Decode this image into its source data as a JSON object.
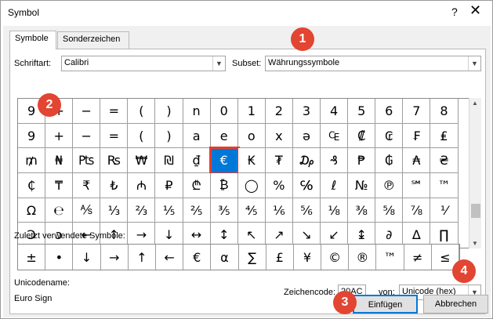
{
  "window": {
    "title": "Symbol",
    "help": "?",
    "close": "✕"
  },
  "tabs": [
    {
      "label": "Symbole"
    },
    {
      "label": "Sonderzeichen"
    }
  ],
  "font": {
    "label": "Schriftart:",
    "value": "Calibri"
  },
  "subset": {
    "label": "Subset:",
    "value": "Währungssymbole"
  },
  "symbol_grid": [
    [
      "9",
      "+",
      "−",
      "=",
      "(",
      ")",
      "n",
      "0",
      "1",
      "2",
      "3",
      "4",
      "5",
      "6",
      "7",
      "8"
    ],
    [
      "9",
      "+",
      "−",
      "=",
      "(",
      ")",
      "a",
      "e",
      "o",
      "x",
      "ə",
      "₠",
      "₡",
      "₢",
      "₣",
      "₤"
    ],
    [
      "₥",
      "₦",
      "₧",
      "₨",
      "₩",
      "₪",
      "₫",
      "€",
      "₭",
      "₮",
      "₯",
      "₰",
      "₱",
      "₲",
      "₳",
      "₴"
    ],
    [
      "₵",
      "₸",
      "₹",
      "₺",
      "₼",
      "₽",
      "₾",
      "₿",
      "◯",
      "%",
      "℅",
      "ℓ",
      "№",
      "℗",
      "℠",
      "™"
    ],
    [
      "Ω",
      "℮",
      "⅍",
      "⅓",
      "⅔",
      "⅕",
      "⅖",
      "⅗",
      "⅘",
      "⅙",
      "⅚",
      "⅛",
      "⅜",
      "⅝",
      "⅞",
      "⅟"
    ],
    [
      "Ↄ",
      "ↄ",
      "←",
      "↑",
      "→",
      "↓",
      "↔",
      "↕",
      "↖",
      "↗",
      "↘",
      "↙",
      "↨",
      "∂",
      "∆",
      "∏"
    ]
  ],
  "recent": {
    "label": "Zuletzt verwendete Symbole:",
    "symbols": [
      "±",
      "•",
      "↓",
      "→",
      "↑",
      "←",
      "€",
      "α",
      "∑",
      "£",
      "¥",
      "©",
      "®",
      "™",
      "≠",
      "≤",
      "≥",
      "÷",
      "×"
    ]
  },
  "unicode": {
    "name_label": "Unicodename:",
    "name": "Euro Sign"
  },
  "char_code": {
    "label": "Zeichencode:",
    "value": "20AC"
  },
  "from": {
    "label": "von:",
    "value": "Unicode (hex)"
  },
  "buttons": {
    "insert": "Einfügen",
    "cancel": "Abbrechen"
  },
  "badges": [
    "1",
    "2",
    "3",
    "4"
  ]
}
